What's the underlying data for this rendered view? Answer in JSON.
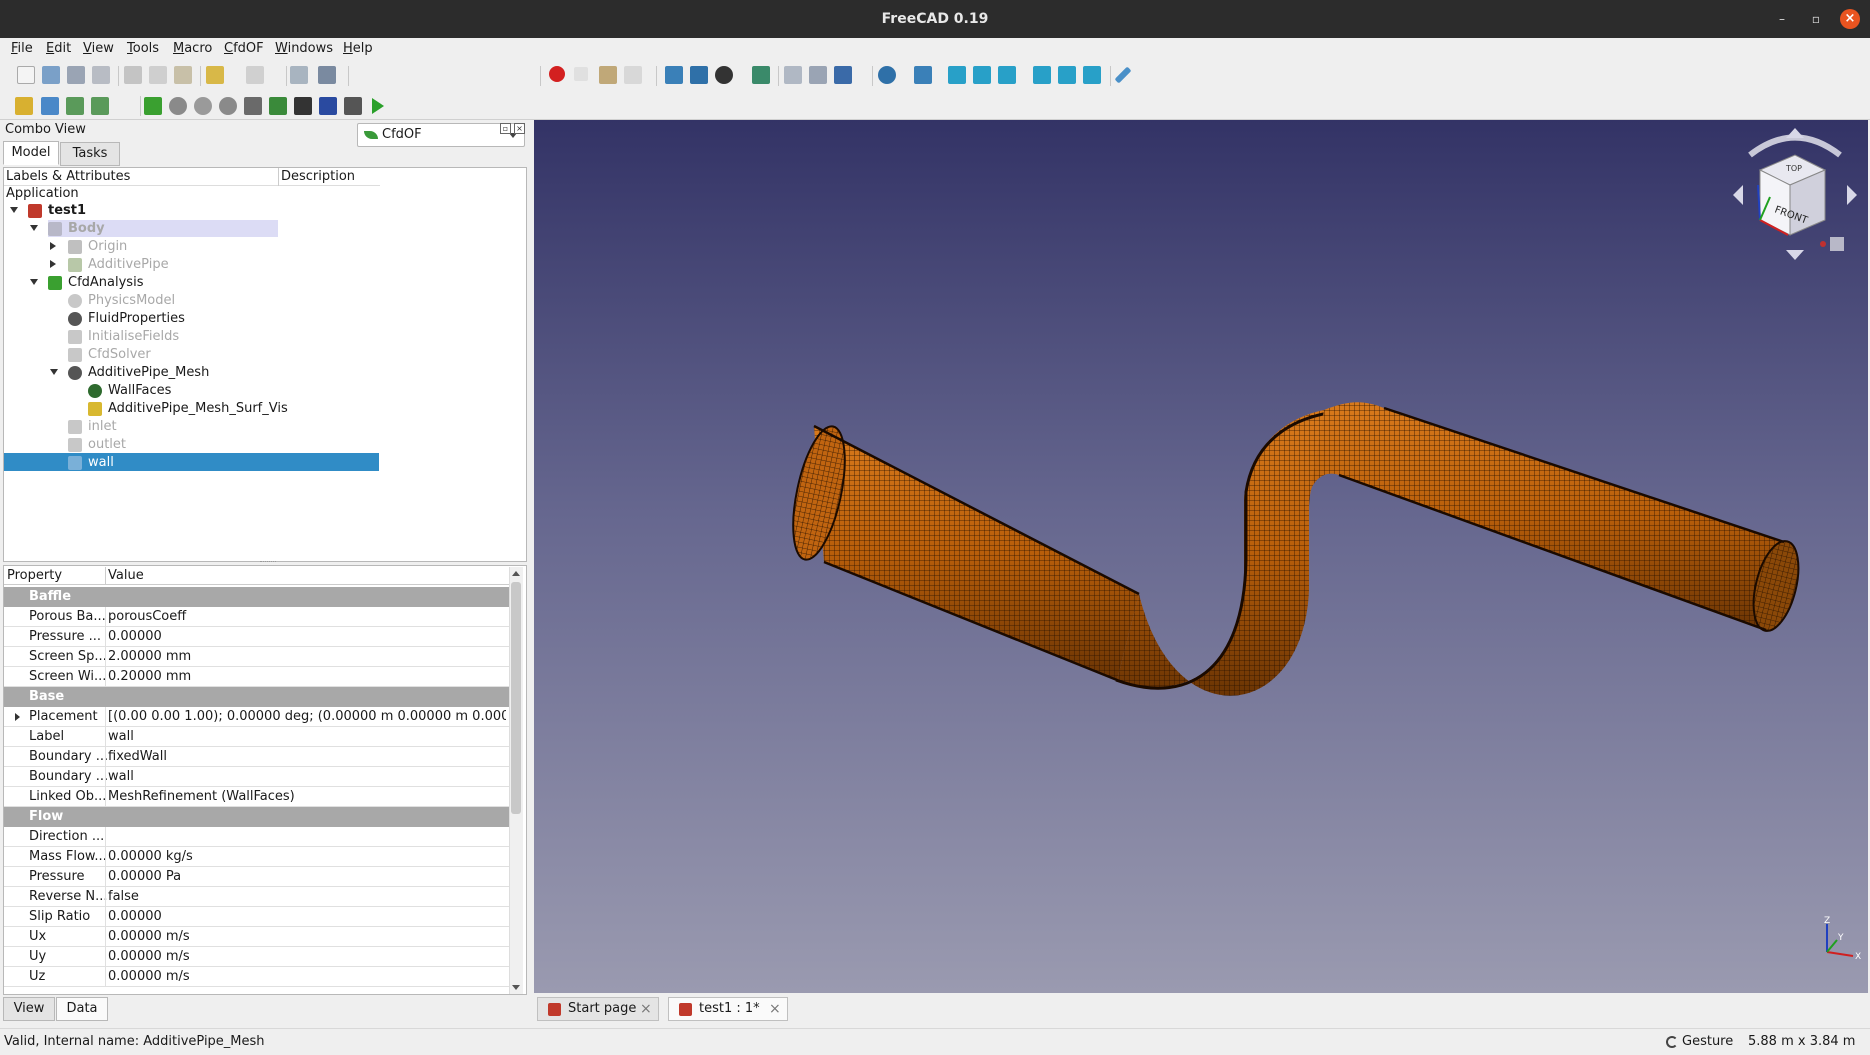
{
  "window": {
    "title": "FreeCAD 0.19"
  },
  "menu": [
    "File",
    "Edit",
    "View",
    "Tools",
    "Macro",
    "CfdOF",
    "Windows",
    "Help"
  ],
  "workbench": {
    "selected": "CfdOF"
  },
  "combo": {
    "title": "Combo View",
    "tabs": [
      "Model",
      "Tasks"
    ]
  },
  "tree": {
    "headers": [
      "Labels & Attributes",
      "Description"
    ],
    "root": "Application",
    "items": [
      {
        "label": "test1",
        "style": "bold"
      },
      {
        "label": "Body",
        "style": "dim-bold"
      },
      {
        "label": "Origin",
        "style": "dim"
      },
      {
        "label": "AdditivePipe",
        "style": "dim"
      },
      {
        "label": "CfdAnalysis",
        "style": "normal"
      },
      {
        "label": "PhysicsModel",
        "style": "dim"
      },
      {
        "label": "FluidProperties",
        "style": "normal"
      },
      {
        "label": "InitialiseFields",
        "style": "dim"
      },
      {
        "label": "CfdSolver",
        "style": "dim"
      },
      {
        "label": "AdditivePipe_Mesh",
        "style": "normal"
      },
      {
        "label": "WallFaces",
        "style": "normal"
      },
      {
        "label": "AdditivePipe_Mesh_Surf_Vis",
        "style": "normal"
      },
      {
        "label": "inlet",
        "style": "dim"
      },
      {
        "label": "outlet",
        "style": "dim"
      },
      {
        "label": "wall",
        "style": "selected"
      }
    ]
  },
  "properties": {
    "headers": [
      "Property",
      "Value"
    ],
    "groups": [
      {
        "name": "Baffle",
        "rows": [
          {
            "name": "Porous Ba...",
            "value": "porousCoeff"
          },
          {
            "name": "Pressure ...",
            "value": "0.00000"
          },
          {
            "name": "Screen Sp...",
            "value": "2.00000 mm"
          },
          {
            "name": "Screen Wi...",
            "value": "0.20000 mm"
          }
        ]
      },
      {
        "name": "Base",
        "rows": [
          {
            "name": "Placement",
            "value": "[(0.00 0.00 1.00); 0.00000 deg; (0.00000 m  0.00000 m  0.000..."
          },
          {
            "name": "Label",
            "value": "wall"
          },
          {
            "name": "Boundary ...",
            "value": "fixedWall"
          },
          {
            "name": "Boundary ...",
            "value": "wall"
          },
          {
            "name": "Linked Ob...",
            "value": "MeshRefinement (WallFaces)"
          }
        ]
      },
      {
        "name": "Flow",
        "rows": [
          {
            "name": "Direction ...",
            "value": ""
          },
          {
            "name": "Mass Flow...",
            "value": "0.00000 kg/s"
          },
          {
            "name": "Pressure",
            "value": "0.00000 Pa"
          },
          {
            "name": "Reverse N...",
            "value": "false"
          },
          {
            "name": "Slip Ratio",
            "value": "0.00000"
          },
          {
            "name": "Ux",
            "value": "0.00000 m/s"
          },
          {
            "name": "Uy",
            "value": "0.00000 m/s"
          },
          {
            "name": "Uz",
            "value": "0.00000 m/s"
          }
        ]
      }
    ]
  },
  "bottom_tabs": [
    "View",
    "Data"
  ],
  "doc_tabs": [
    {
      "label": "Start page",
      "active": false
    },
    {
      "label": "test1 : 1*",
      "active": true
    }
  ],
  "navcube": {
    "face": "FRONT",
    "top": "TOP"
  },
  "axes": {
    "x": "X",
    "y": "Y",
    "z": "Z"
  },
  "status": {
    "message": "Valid, Internal name: AdditivePipe_Mesh",
    "nav_style": "Gesture",
    "dimensions": "5.88 m x 3.84 m"
  },
  "colors": {
    "selection": "#308cc6",
    "mesh": "#c8620a",
    "close_button": "#e95420"
  }
}
